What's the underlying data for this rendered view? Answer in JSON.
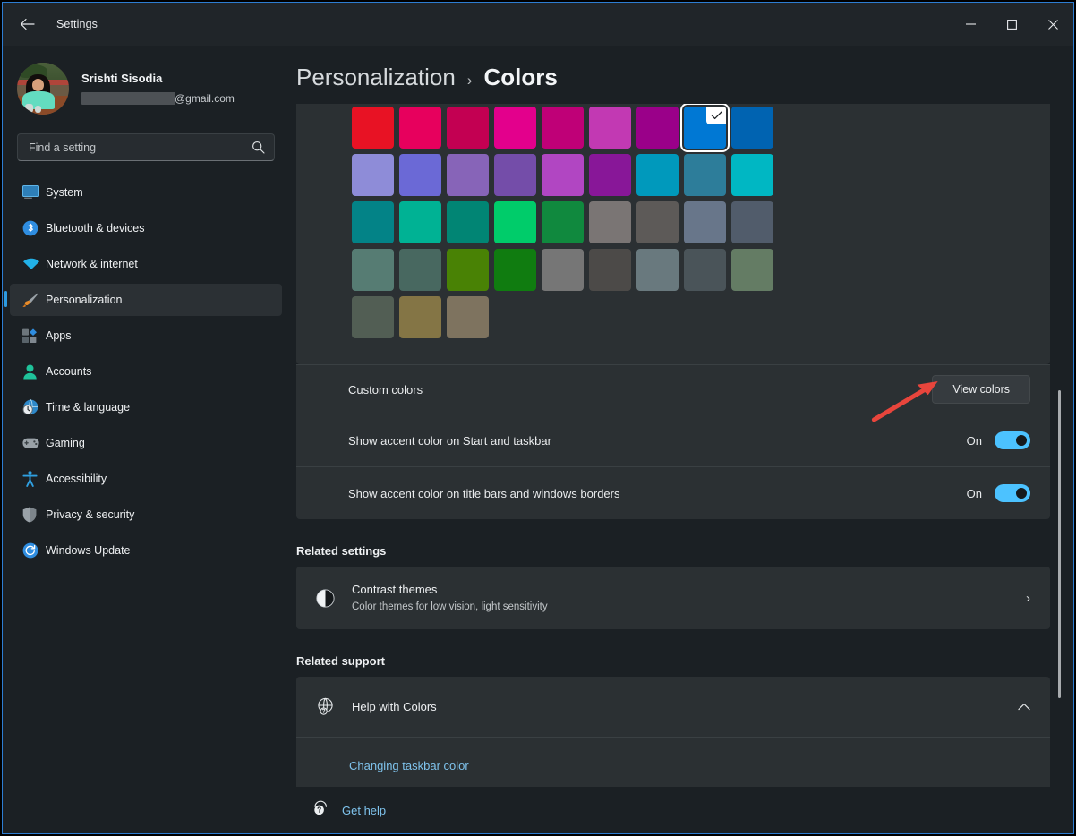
{
  "window": {
    "title": "Settings",
    "back_label": "Back",
    "minimize_label": "Minimize",
    "maximize_label": "Maximize",
    "close_label": "Close",
    "accent_color": "#2d7dd2"
  },
  "account": {
    "name": "Srishti Sisodia",
    "email_suffix": "@gmail.com",
    "email_redacted": true
  },
  "search": {
    "placeholder": "Find a setting",
    "value": ""
  },
  "sidebar": {
    "items": [
      {
        "label": "System",
        "icon": "monitor-icon",
        "active": false
      },
      {
        "label": "Bluetooth & devices",
        "icon": "bluetooth-icon",
        "active": false
      },
      {
        "label": "Network & internet",
        "icon": "wifi-icon",
        "active": false
      },
      {
        "label": "Personalization",
        "icon": "paintbrush-icon",
        "active": true
      },
      {
        "label": "Apps",
        "icon": "apps-icon",
        "active": false
      },
      {
        "label": "Accounts",
        "icon": "person-icon",
        "active": false
      },
      {
        "label": "Time & language",
        "icon": "clock-globe-icon",
        "active": false
      },
      {
        "label": "Gaming",
        "icon": "gamepad-icon",
        "active": false
      },
      {
        "label": "Accessibility",
        "icon": "accessibility-icon",
        "active": false
      },
      {
        "label": "Privacy & security",
        "icon": "shield-icon",
        "active": false
      },
      {
        "label": "Windows Update",
        "icon": "refresh-icon",
        "active": false
      }
    ]
  },
  "breadcrumb": {
    "parent": "Personalization",
    "separator": "›",
    "current": "Colors"
  },
  "accent_swatches": {
    "selected_index": 7,
    "selected_color": "#0078d4",
    "rows": [
      [
        "#e81224",
        "#e7005d",
        "#c30052",
        "#e3008c",
        "#bf0077",
        "#c239b3",
        "#9a0089",
        "#0078d4",
        "#0063b1"
      ],
      [
        "#8e8cd8",
        "#6b69d6",
        "#8764b8",
        "#744da9",
        "#b146c2",
        "#881798",
        "#0099bc",
        "#2d7d9a",
        "#00b7c3"
      ],
      [
        "#038387",
        "#00b294",
        "#018574",
        "#00cc6a",
        "#10893e",
        "#7a7574",
        "#5d5a58",
        "#68768a",
        "#515c6b"
      ],
      [
        "#567c73",
        "#486860",
        "#498205",
        "#107c10",
        "#767676",
        "#4c4a48",
        "#69797e",
        "#4a5459",
        "#647c64"
      ],
      [
        "#525e54",
        "#847545",
        "#7e735f"
      ]
    ]
  },
  "settings_rows": {
    "custom_colors": {
      "label": "Custom colors",
      "button_label": "View colors"
    },
    "accent_start_taskbar": {
      "label": "Show accent color on Start and taskbar",
      "state_label": "On",
      "state": true
    },
    "accent_titlebars": {
      "label": "Show accent color on title bars and windows borders",
      "state_label": "On",
      "state": true
    }
  },
  "related_settings": {
    "heading": "Related settings",
    "items": [
      {
        "title": "Contrast themes",
        "subtitle": "Color themes for low vision, light sensitivity",
        "icon": "contrast-icon",
        "chevron": "›"
      }
    ]
  },
  "related_support": {
    "heading": "Related support",
    "group_title": "Help with Colors",
    "group_icon": "globe-help-icon",
    "expand_chevron": "ⱏ",
    "links": [
      "Changing taskbar color"
    ]
  },
  "footer": {
    "get_help_label": "Get help",
    "icon": "help-balloon-icon"
  },
  "annotation": {
    "type": "red-arrow",
    "color": "#e8453c",
    "points_to": "View colors"
  },
  "scrollbar": {
    "thumb_top_pct": 42,
    "thumb_height_pct": 45
  }
}
